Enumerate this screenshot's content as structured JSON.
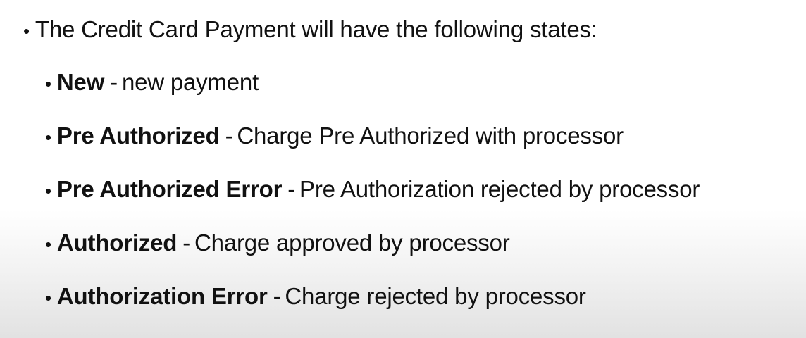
{
  "heading": {
    "text": "The Credit Card Payment will have the following states:"
  },
  "separator": "-",
  "states": [
    {
      "term": "New",
      "description": "new payment"
    },
    {
      "term": "Pre Authorized",
      "description": "Charge Pre Authorized with processor"
    },
    {
      "term": "Pre Authorized Error",
      "description": "Pre Authorization rejected by processor"
    },
    {
      "term": "Authorized",
      "description": "Charge approved by processor"
    },
    {
      "term": "Authorization Error",
      "description": "Charge rejected by processor"
    }
  ]
}
